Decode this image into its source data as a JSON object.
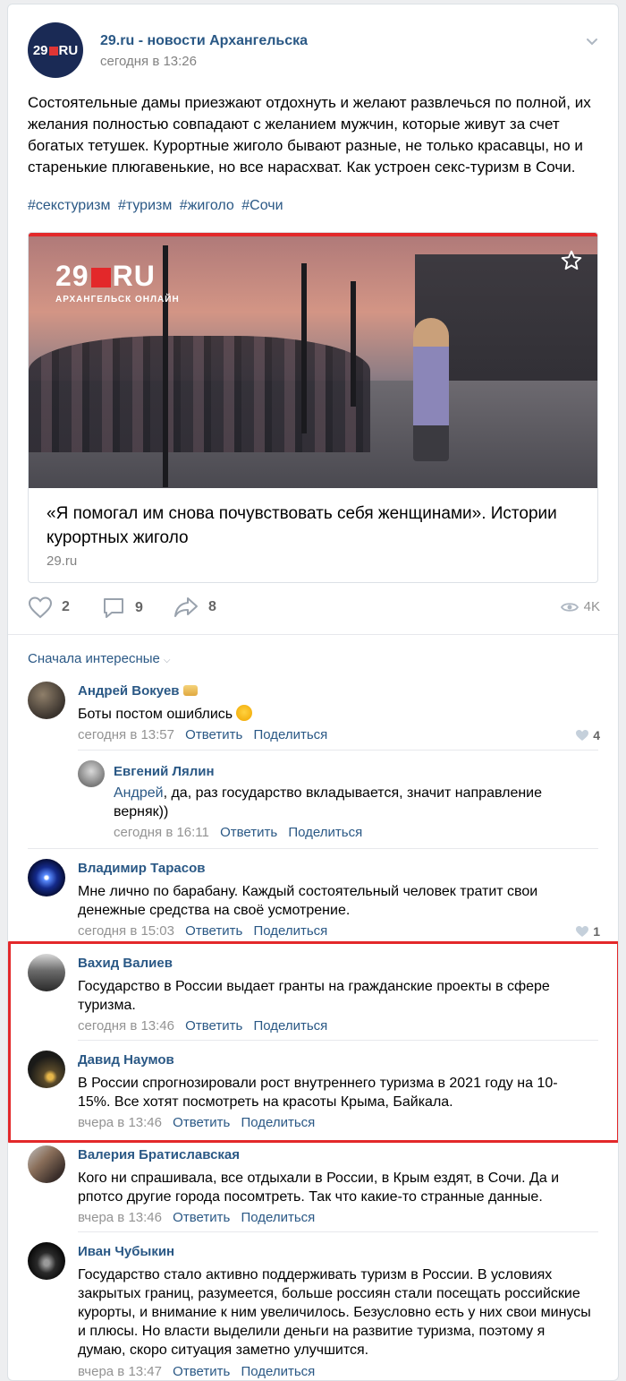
{
  "post": {
    "author": "29.ru - новости Архангельска",
    "avatar_text": "29",
    "avatar_suffix": "RU",
    "date": "сегодня в 13:26",
    "text": "Состоятельные дамы приезжают отдохнуть и желают развлечься по полной, их желания полностью совпадают с желанием мужчин, которые живут за счет богатых тетушек. Курортные жиголо бывают разные, не только красавцы, но и старенькие плюгавенькие, но все нарасхват. Как устроен секс-туризм в Сочи.",
    "tags": [
      "#секстуризм",
      "#туризм",
      "#жиголо",
      "#Сочи"
    ],
    "snippet": {
      "logo_num": "29",
      "logo_suffix": "RU",
      "logo_sub": "АРХАНГЕЛЬСК ОНЛАЙН",
      "title": "«Я помогал им снова почувствовать себя женщинами». Истории курортных жиголо",
      "source": "29.ru"
    },
    "likes": "2",
    "comments": "9",
    "shares": "8",
    "views": "4K"
  },
  "comments_sort": "Сначала интересные",
  "action_reply": "Ответить",
  "action_share": "Поделиться",
  "comments": [
    {
      "name": "Андрей Вокуев",
      "text": "Боты постом ошиблись",
      "date": "сегодня в 13:57",
      "likes": "4"
    },
    {
      "name": "Евгений Лялин",
      "ref": "Андрей",
      "text": ", да, раз государство вкладывается, значит направление верняк))",
      "date": "сегодня в 16:11"
    },
    {
      "name": "Владимир Тарасов",
      "text": "Мне лично по барабану. Каждый состоятельный человек тратит свои денежные средства на своё усмотрение.",
      "date": "сегодня в 15:03",
      "likes": "1"
    },
    {
      "name": "Вахид Валиев",
      "text": "Государство в России выдает гранты на гражданские проекты в сфере туризма.",
      "date": "сегодня в 13:46"
    },
    {
      "name": "Давид Наумов",
      "text": "В России спрогнозировали рост внутреннего туризма в 2021 году на 10-15%. Все хотят посмотреть на красоты Крыма, Байкала.",
      "date": "вчера в 13:46"
    },
    {
      "name": "Валерия Братиславская",
      "text": "Кого ни спрашивала, все отдыхали в России, в Крым ездят, в Сочи. Да и рпотсо другие города посомтреть. Так что какие-то странные данные.",
      "date": "вчера в 13:46"
    },
    {
      "name": "Иван Чубыкин",
      "text": "Государство стало активно поддерживать туризм в России. В условиях закрытых границ, разумеется, больше россиян стали посещать российские курорты, и внимание к ним увеличилось. Безусловно есть у них свои минусы и плюсы. Но власти выделили деньги на развитие туризма, поэтому я думаю, скоро ситуация заметно улучшится.",
      "date": "вчера в 13:47"
    }
  ]
}
